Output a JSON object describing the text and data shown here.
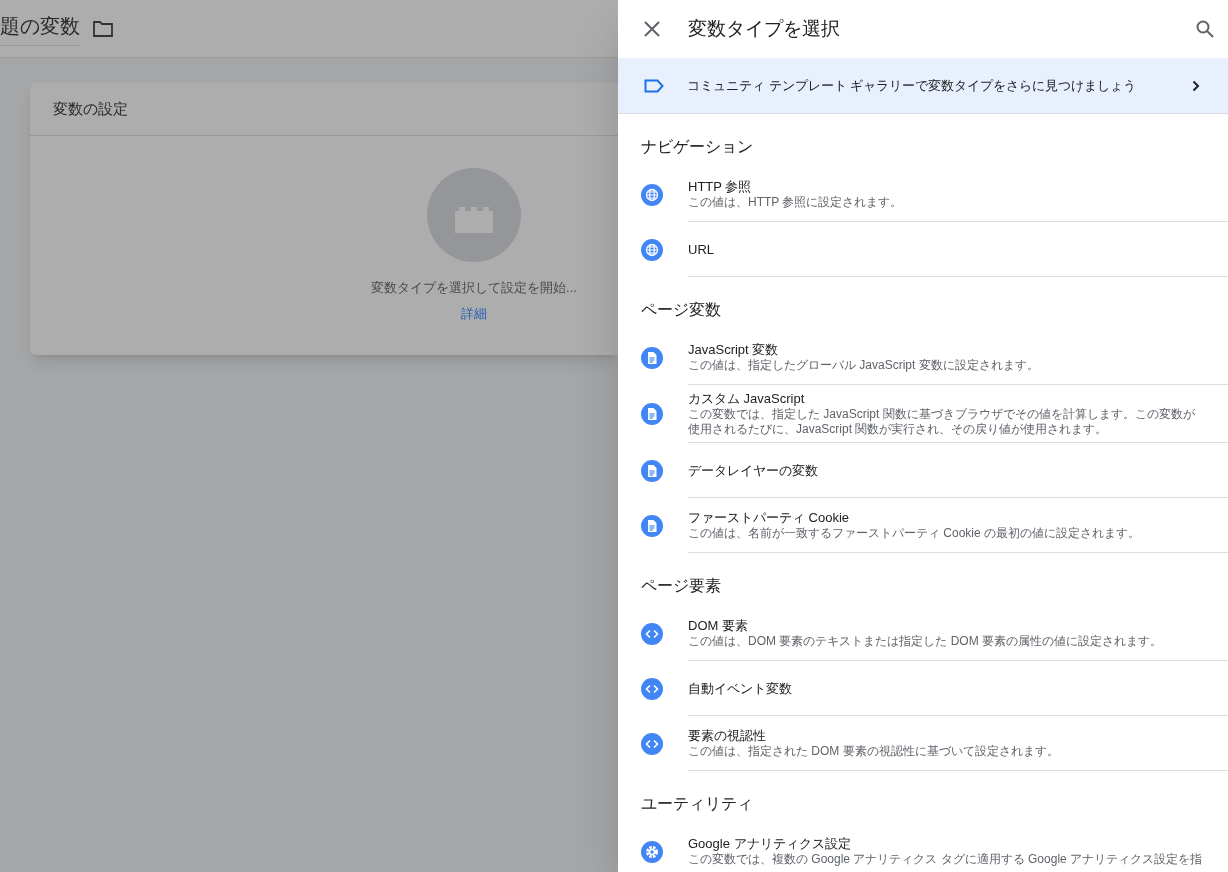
{
  "background": {
    "title": "題の変数",
    "card": {
      "title": "変数の設定",
      "hint": "変数タイプを選択して設定を開始...",
      "link": "詳細"
    }
  },
  "panel": {
    "title": "変数タイプを選択",
    "banner": "コミュニティ テンプレート ギャラリーで変数タイプをさらに見つけましょう",
    "sections": [
      {
        "title": "ナビゲーション",
        "items": [
          {
            "kind": "globe",
            "name": "HTTP 参照",
            "description": "この値は、HTTP 参照に設定されます。"
          },
          {
            "kind": "globe",
            "name": "URL"
          }
        ]
      },
      {
        "title": "ページ変数",
        "items": [
          {
            "kind": "document",
            "name": "JavaScript 変数",
            "description": "この値は、指定したグローバル JavaScript 変数に設定されます。"
          },
          {
            "kind": "document",
            "name": "カスタム JavaScript",
            "description": "この変数では、指定した JavaScript 関数に基づきブラウザでその値を計算します。この変数が使用されるたびに、JavaScript 関数が実行され、その戻り値が使用されます。"
          },
          {
            "kind": "document",
            "name": "データレイヤーの変数"
          },
          {
            "kind": "document",
            "name": "ファーストパーティ Cookie",
            "description": "この値は、名前が一致するファーストパーティ Cookie の最初の値に設定されます。"
          }
        ]
      },
      {
        "title": "ページ要素",
        "items": [
          {
            "kind": "code",
            "name": "DOM 要素",
            "description": "この値は、DOM 要素のテキストまたは指定した DOM 要素の属性の値に設定されます。"
          },
          {
            "kind": "code",
            "name": "自動イベント変数"
          },
          {
            "kind": "code",
            "name": "要素の視認性",
            "description": "この値は、指定された DOM 要素の視認性に基づいて設定されます。"
          }
        ]
      },
      {
        "title": "ユーティリティ",
        "items": [
          {
            "kind": "gear",
            "name": "Google アナリティクス設定",
            "description": "この変数では、複数の Google アナリティクス タグに適用する Google アナリティクス設定を指"
          }
        ]
      }
    ]
  }
}
